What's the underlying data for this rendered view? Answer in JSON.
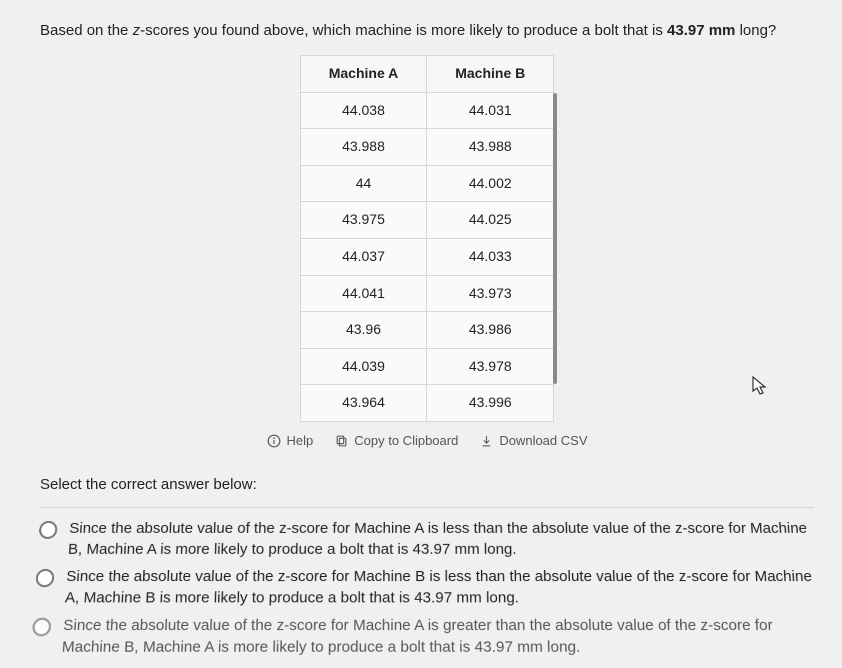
{
  "question": {
    "pre": "Based on the ",
    "z": "z",
    "mid": "-scores you found above, which machine is more likely to produce a bolt that is ",
    "val": "43.97 mm",
    "post": " long?"
  },
  "table": {
    "headers": [
      "Machine A",
      "Machine B"
    ],
    "rows": [
      [
        "44.038",
        "44.031"
      ],
      [
        "43.988",
        "43.988"
      ],
      [
        "44",
        "44.002"
      ],
      [
        "43.975",
        "44.025"
      ],
      [
        "44.037",
        "44.033"
      ],
      [
        "44.041",
        "43.973"
      ],
      [
        "43.96",
        "43.986"
      ],
      [
        "44.039",
        "43.978"
      ],
      [
        "43.964",
        "43.996"
      ]
    ]
  },
  "actions": {
    "help": "Help",
    "copy": "Copy to Clipboard",
    "csv": "Download CSV"
  },
  "prompt": "Select the correct answer below:",
  "choices": [
    {
      "p1": "Since the absolute value of the ",
      "p2": "-score for Machine A is less than the absolute value of the ",
      "p3": "-score for Machine B, Machine A is more likely to produce a bolt that is ",
      "v": "43.97 mm",
      "p4": " long."
    },
    {
      "p1": "Since the absolute value of the ",
      "p2": "-score for Machine B is less than the absolute value of the ",
      "p3": "-score for Machine A, Machine B is more likely to produce a bolt that is ",
      "v": "43.97 mm",
      "p4": " long."
    },
    {
      "p1": "Since the absolute value of the ",
      "p2": "-score for Machine A is greater than the absolute value of the ",
      "p3": "-score for Machine B, Machine A is more likely to produce a bolt that is ",
      "v": "43.97 mm",
      "p4": " long."
    }
  ]
}
